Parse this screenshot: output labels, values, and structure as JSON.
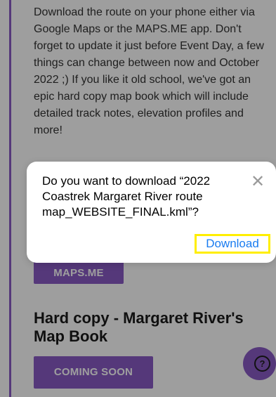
{
  "intro": {
    "paragraph": "Download the route on your phone either via Google Maps or the MAPS.ME app. Don't forget to update it just before Event Day, a few things can change between now and October 2022 ;) If you like it old school, we've got an epic hard copy map book which will include detailed track notes, elevation profiles and more!"
  },
  "maps_button": {
    "label": "MAPS.ME"
  },
  "hardcopy": {
    "title": "Hard copy - Margaret River's Map Book",
    "button_label": "COMING SOON"
  },
  "help": {
    "symbol": "?"
  },
  "dialog": {
    "message": "Do you want to download “2022 Coastrek Margaret River route map_WEBSITE_FINAL.kml”?",
    "close_symbol": "✕",
    "download_label": "Download"
  },
  "colors": {
    "accent": "#8a5bc6",
    "link_blue": "#1a7cf0",
    "highlight": "#ffee00"
  }
}
